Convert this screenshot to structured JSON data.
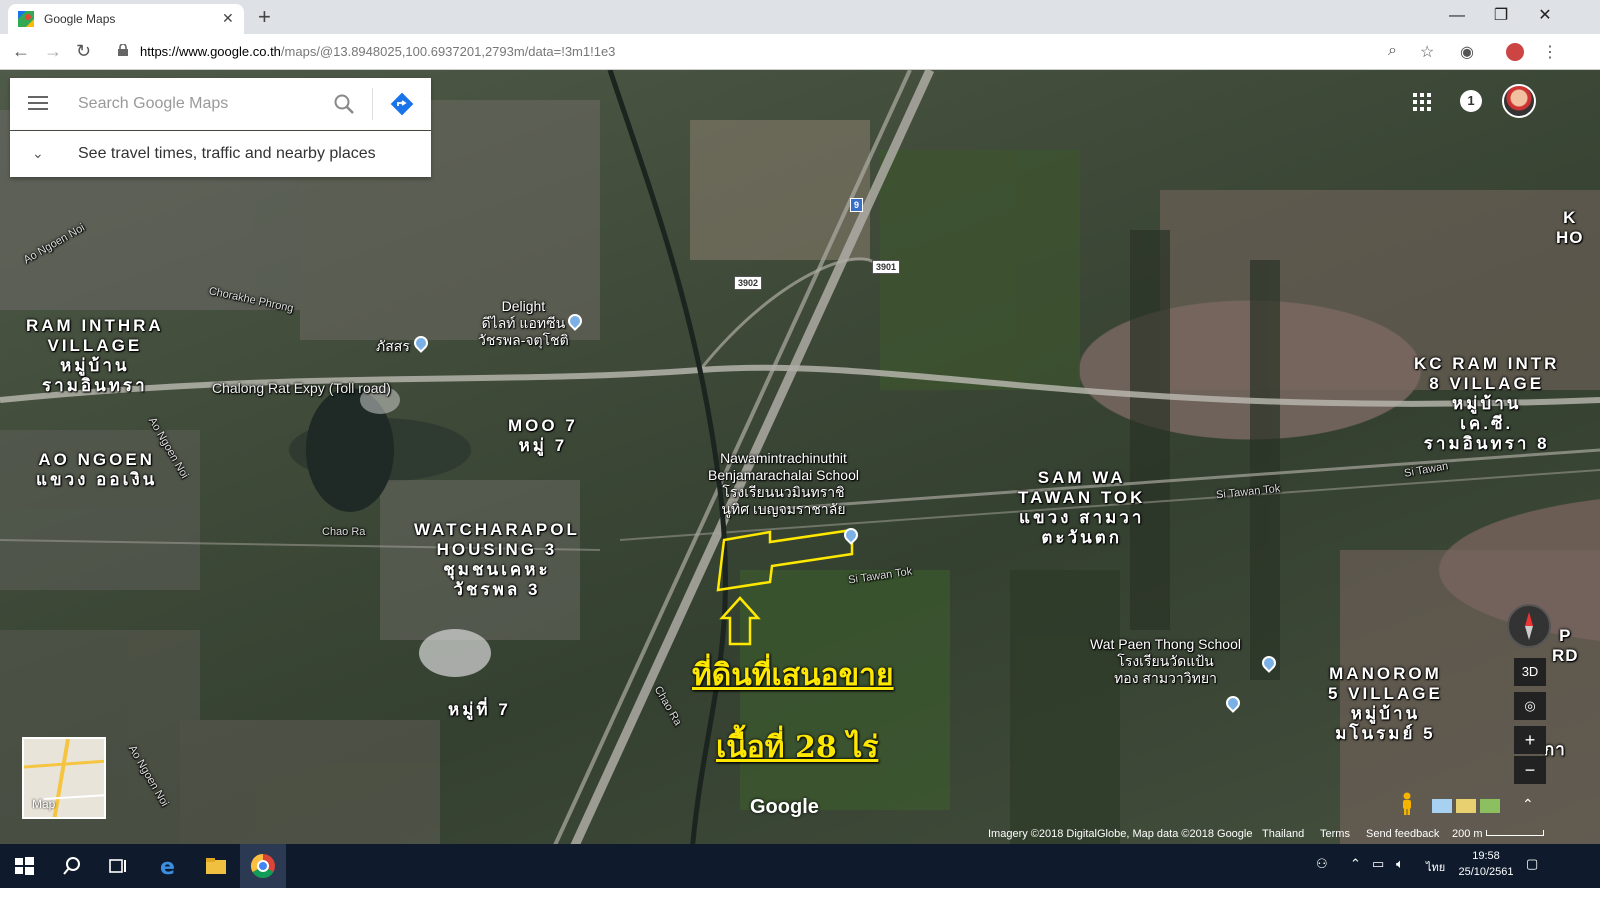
{
  "browser": {
    "tab_title": "Google Maps",
    "url_host": "https://www.google.co.th",
    "url_path": "/maps/@13.8948025,100.6937201,2793m/data=!3m1!1e3"
  },
  "search": {
    "placeholder": "Search Google Maps",
    "travel_text": "See travel times, traffic and nearby places"
  },
  "header": {
    "notification_count": "1"
  },
  "map_labels": {
    "ram_intra_1": "RAM INTHRA",
    "ram_intra_2": "VILLAGE",
    "ram_intra_3": "หมู่บ้าน",
    "ram_intra_4": "รามอินทรา",
    "ao_ngoen_1": "AO NGOEN",
    "ao_ngoen_2": "แขวง ออเงิน",
    "moo7_1": "MOO 7",
    "moo7_2": "หมู่ 7",
    "watch_1": "WATCHARAPOL",
    "watch_2": "HOUSING 3",
    "watch_3": "ชุมชนเคหะ",
    "watch_4": "วัชรพล 3",
    "moo7b": "หมู่ที่ 7",
    "samwa_1": "SAM WA",
    "samwa_2": "TAWAN TOK",
    "samwa_3": "แขวง สามวา",
    "samwa_4": "ตะวันตก",
    "kc_1": "KC RAM INTR",
    "kc_2": "8 VILLAGE",
    "kc_3": "หมู่บ้าน",
    "kc_4": "เค.ซี.",
    "kc_5": "รามอินทรา 8",
    "manorom_1": "MANOROM",
    "manorom_2": "5 VILLAGE",
    "manorom_3": "หมู่บ้าน",
    "manorom_4": "มโนรมย์ 5",
    "delight_1": "Delight",
    "delight_2": "ดีไลท์ แอทซีน",
    "delight_3": "วัชรพล-จตุโชติ",
    "phatsorn": "ภัสสร",
    "school_1": "Nawamintrachinuthit",
    "school_2": "Benjamarachalai School",
    "school_3": "โรงเรียนนวมินทราชิ",
    "school_4": "นูทิศ เบญจมราชาลัย",
    "watpaen_1": "Wat Paen Thong School",
    "watpaen_2": "โรงเรียนวัดแป้น",
    "watpaen_3": "ทอง สามวาวิทยา",
    "chalong": "Chalong Rat Expy (Toll road)",
    "chorakhe": "Chorakhe Phrong",
    "chao_ra_1": "Chao Ra",
    "chao_ra_2": "Chao Ra",
    "ao_ngoen_noi_1": "Ao Ngoen Noi",
    "ao_ngoen_noi_2": "Ao Ngoen Noi",
    "ao_ngoen_noi_3": "Ao Ngoen Noi",
    "si_tawan_tok_1": "Si Tawan Tok",
    "si_tawan_tok_2": "Si Tawan Tok",
    "si_tawan_tok_3": "Si Tawan",
    "ko_1": "K",
    "ko_2": "HO",
    "pa_1": "P",
    "pa_2": "RD",
    "ka": "กา",
    "highway_9": "9",
    "highway_3902": "3902",
    "highway_3901": "3901"
  },
  "annotations": {
    "for_sale": "ที่ดินที่เสนอขาย",
    "area": "เนื้อที่ 28 ไร่"
  },
  "controls": {
    "btn_3d": "3D",
    "zoom_in": "+",
    "zoom_out": "−",
    "minimap_label": "Map",
    "google_logo": "Google"
  },
  "footer": {
    "imagery": "Imagery ©2018 DigitalGlobe, Map data ©2018 Google",
    "country": "Thailand",
    "terms": "Terms",
    "feedback": "Send feedback",
    "scale": "200 m"
  },
  "taskbar": {
    "time": "19:58",
    "date": "25/10/2561",
    "lang": "ไทย"
  },
  "colors": {
    "annotation": "#ffe800",
    "taskbar": "#0f1b2d",
    "directions_blue": "#1a73e8"
  }
}
